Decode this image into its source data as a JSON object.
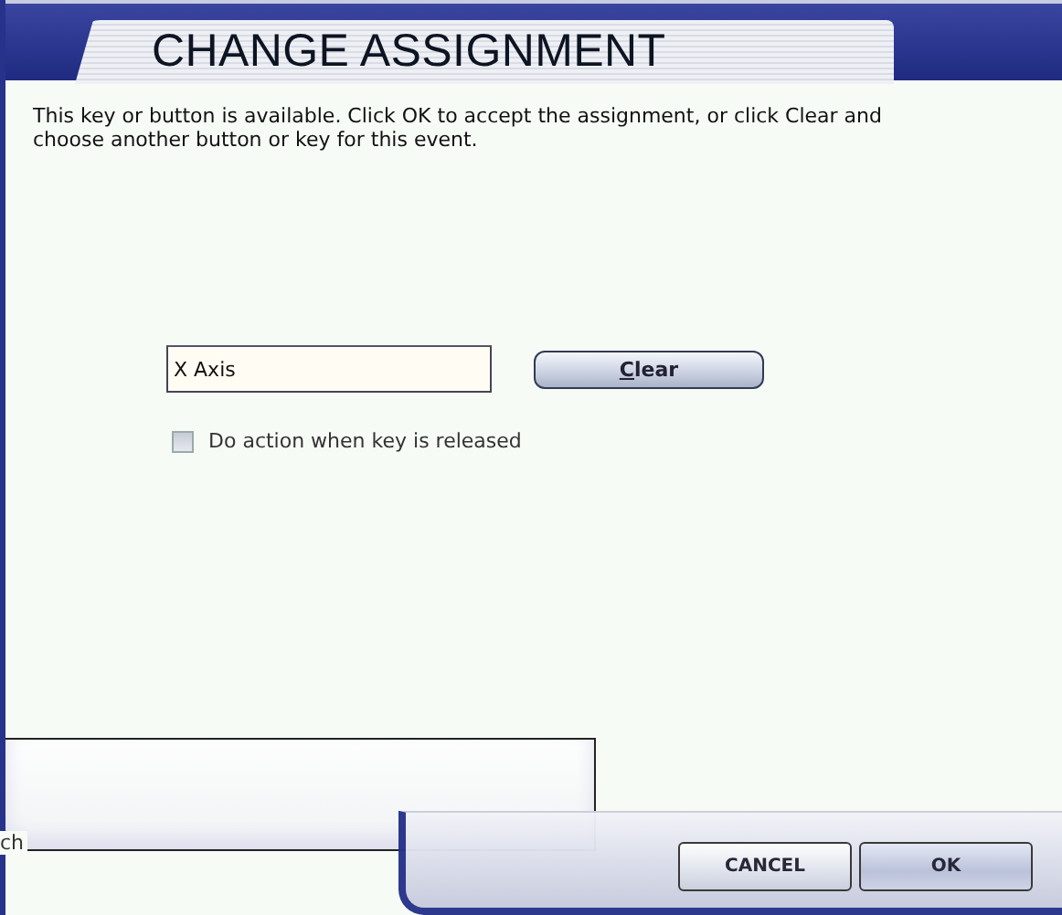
{
  "window": {
    "title": "CHANGE ASSIGNMENT"
  },
  "message": "This key or button is available. Click OK to accept the assignment, or click Clear and choose another button or key for this event.",
  "assignment": {
    "value": "X Axis"
  },
  "clear_button": "Clear",
  "release_option": {
    "label": "Do action when key is released",
    "checked": false
  },
  "background_text": "ch",
  "buttons": [
    {
      "label": "CANCEL",
      "kind": "cancel"
    },
    {
      "label": "OK",
      "kind": "ok"
    }
  ]
}
